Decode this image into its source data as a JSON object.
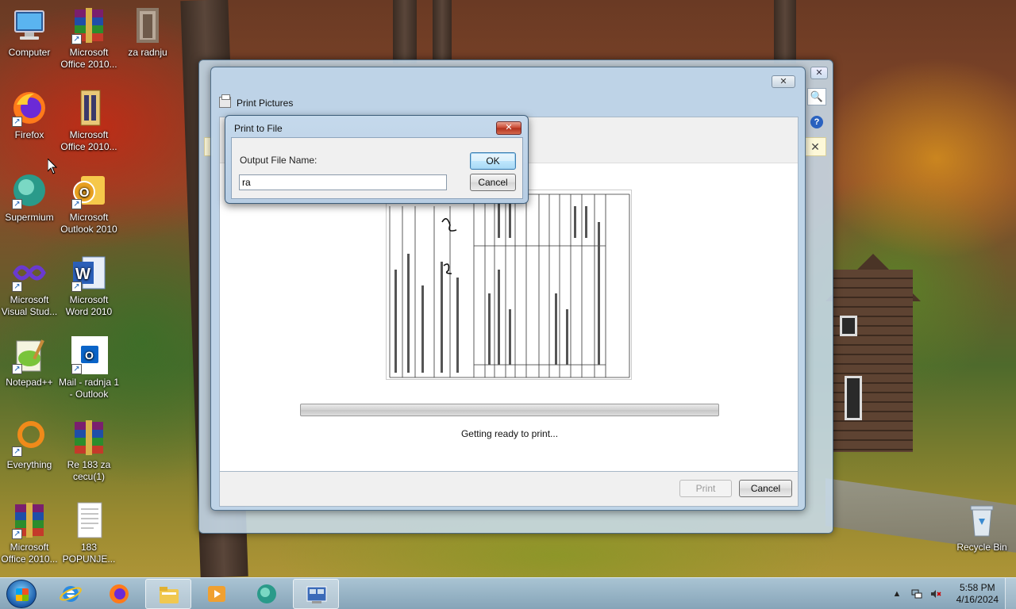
{
  "desktop": {
    "icons": [
      {
        "label": "Computer"
      },
      {
        "label": "Microsoft Office 2010..."
      },
      {
        "label": "za radnju"
      },
      {
        "label": "Firefox"
      },
      {
        "label": "Microsoft Office 2010..."
      },
      {
        "label": "Supermium"
      },
      {
        "label": "Microsoft Outlook 2010"
      },
      {
        "label": "Microsoft Visual Stud..."
      },
      {
        "label": "Microsoft Word 2010"
      },
      {
        "label": "Notepad++"
      },
      {
        "label": "Mail - radnja 1 - Outlook"
      },
      {
        "label": "Everything"
      },
      {
        "label": "Re 183 za cecu(1)"
      },
      {
        "label": "Microsoft Office 2010..."
      },
      {
        "label": "183 POPUNJE..."
      },
      {
        "label": "Recycle Bin"
      }
    ]
  },
  "outer_window": {
    "close_glyph": "✕",
    "search_glyph": "🔍",
    "help_glyph": "?",
    "infobar_close_glyph": "✕"
  },
  "print_pictures": {
    "title": "Print Pictures",
    "close_glyph": "✕",
    "status_text": "Getting ready to print...",
    "progress_fraction": 0.0,
    "print_label": "Print",
    "cancel_label": "Cancel"
  },
  "print_to_file": {
    "title": "Print to File",
    "close_glyph": "✕",
    "output_label": "Output File Name:",
    "input_value": "ra",
    "ok_label": "OK",
    "cancel_label": "Cancel"
  },
  "taskbar": {
    "time": "5:58 PM",
    "date": "4/16/2024",
    "tray_arrow": "▲"
  }
}
